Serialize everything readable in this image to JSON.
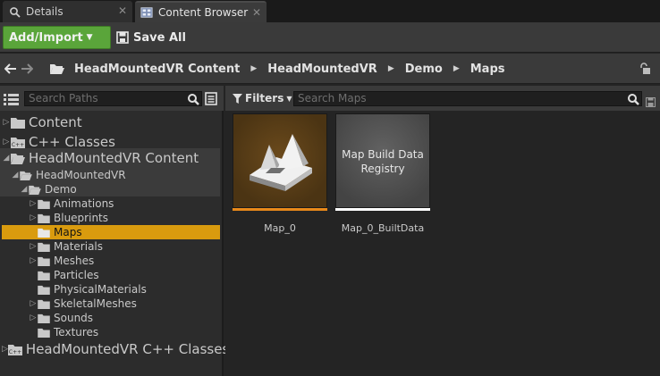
{
  "tabs": [
    {
      "label": "Details",
      "icon": "search-icon"
    },
    {
      "label": "Content Browser",
      "icon": "content-browser-icon"
    }
  ],
  "toolbar": {
    "add_label": "Add/Import",
    "save_label": "Save All",
    "add_color": "#5aa53a"
  },
  "breadcrumb": {
    "items": [
      "HeadMountedVR Content",
      "HeadMountedVR",
      "Demo",
      "Maps"
    ]
  },
  "sources": {
    "search_placeholder": "Search Paths",
    "tree": [
      {
        "label": "Content"
      },
      {
        "label": "C++ Classes"
      },
      {
        "label": "HeadMountedVR Content"
      },
      {
        "label": "HeadMountedVR"
      },
      {
        "label": "Demo"
      },
      {
        "label": "Animations"
      },
      {
        "label": "Blueprints"
      },
      {
        "label": "Maps"
      },
      {
        "label": "Materials"
      },
      {
        "label": "Meshes"
      },
      {
        "label": "Particles"
      },
      {
        "label": "PhysicalMaterials"
      },
      {
        "label": "SkeletalMeshes"
      },
      {
        "label": "Sounds"
      },
      {
        "label": "Textures"
      },
      {
        "label": "HeadMountedVR C++ Classes"
      }
    ],
    "selected_color": "#d99b0e"
  },
  "assets": {
    "filters_label": "Filters",
    "search_placeholder": "Search Maps",
    "items": [
      {
        "name": "Map_0",
        "thumb_text": "",
        "type_color": "#e8891a"
      },
      {
        "name": "Map_0_BuiltData",
        "thumb_text": "Map Build Data Registry",
        "type_color": "#ffffff"
      }
    ]
  }
}
